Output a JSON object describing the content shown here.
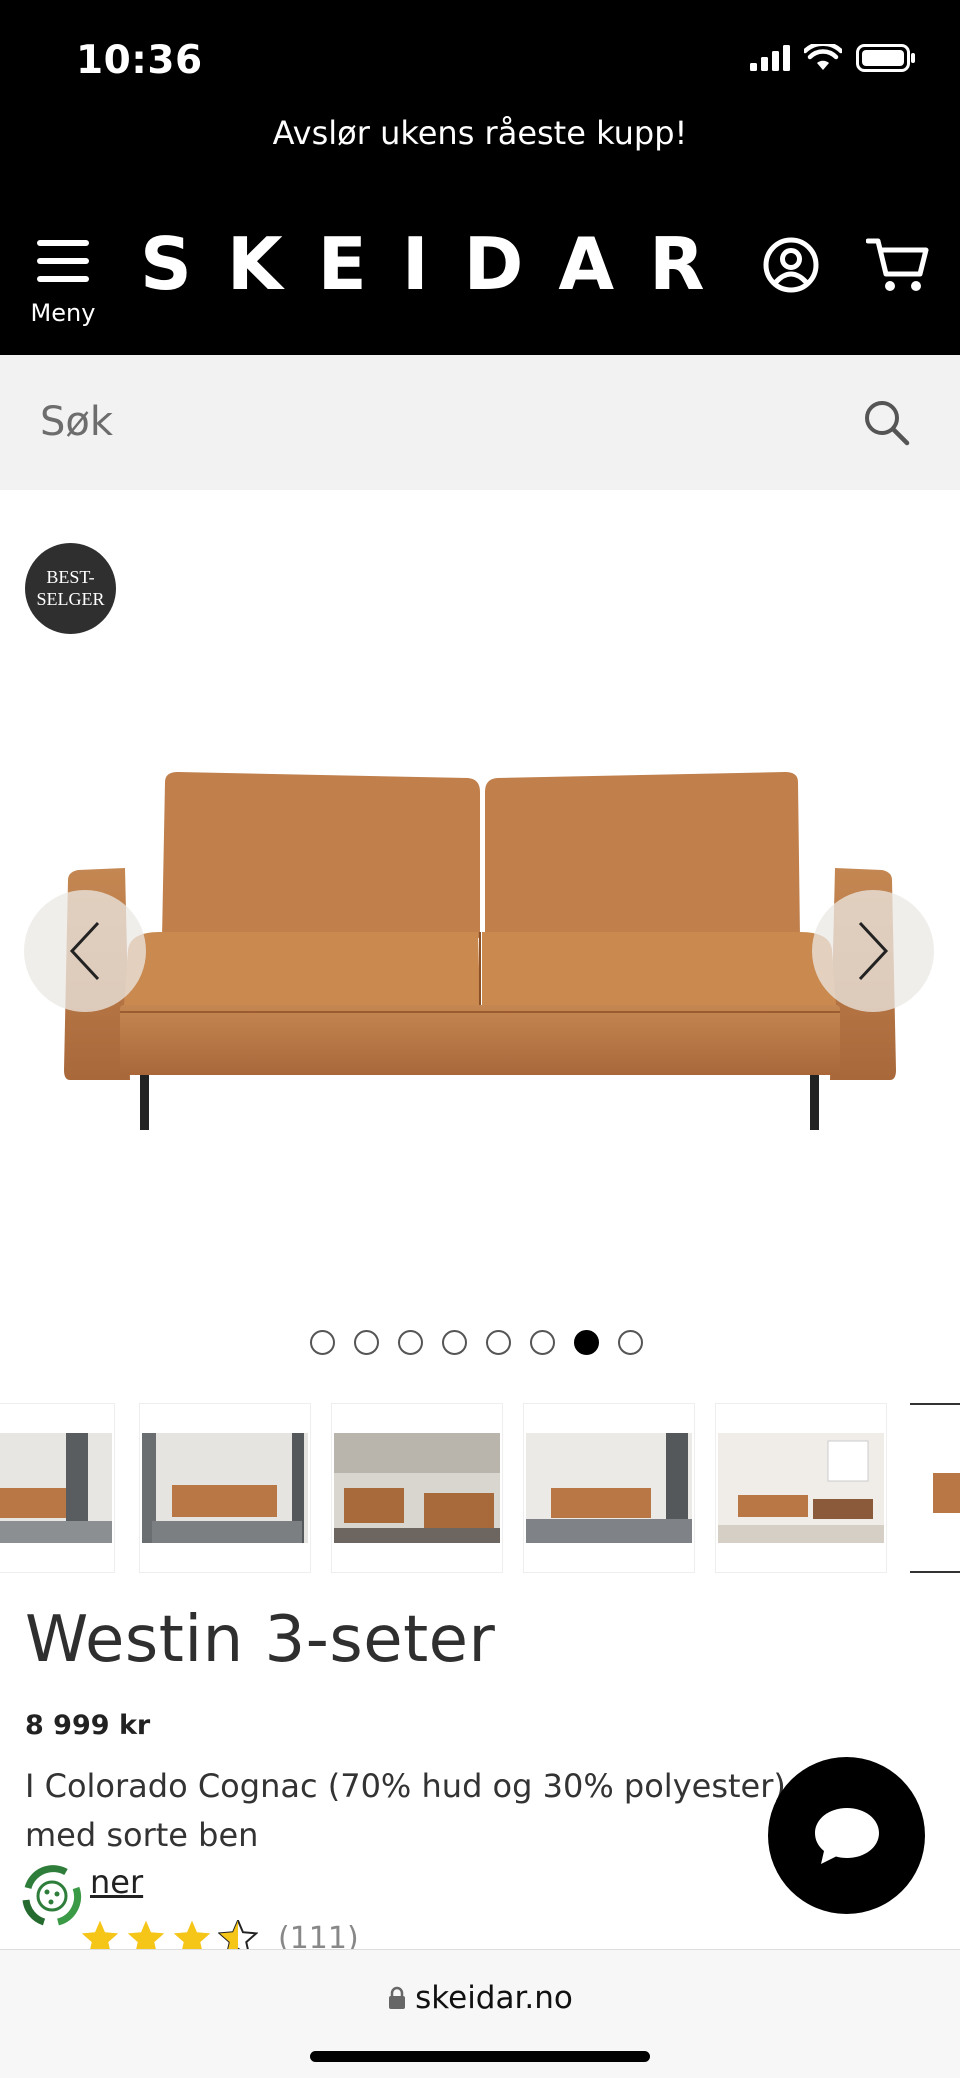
{
  "status_bar": {
    "time": "10:36"
  },
  "header": {
    "announcement": "Avslør ukens råeste kupp!",
    "menu_label": "Meny",
    "logo_text": "SKEIDAR"
  },
  "search": {
    "placeholder": "Søk"
  },
  "product": {
    "badge_line1": "BEST-",
    "badge_line2": "SELGER",
    "title": "Westin 3-seter",
    "price": "8 999 kr",
    "description": "I Colorado Cognac (70% hud og 30% polyester) med sorte ben",
    "more_link": "ner",
    "rating_value": 3.5,
    "rating_max": 5,
    "review_count": "(111)",
    "image_count": 8,
    "active_image": 7
  },
  "browser": {
    "url": "skeidar.no"
  },
  "colors": {
    "header_bg": "#000000",
    "search_bg": "#f2f2f2",
    "leather": "#b87745",
    "star": "#f5c518"
  }
}
